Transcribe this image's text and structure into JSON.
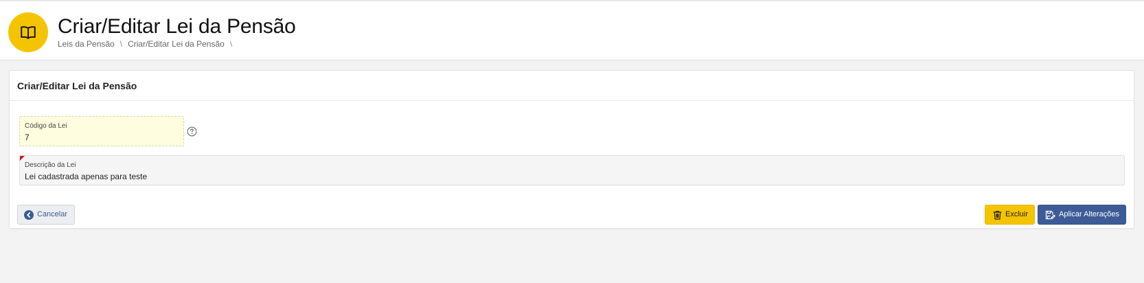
{
  "header": {
    "icon": "book-open-icon",
    "title": "Criar/Editar Lei da Pensão",
    "breadcrumb": [
      {
        "label": "Leis da Pensão"
      },
      {
        "label": "Criar/Editar Lei da Pensão"
      }
    ],
    "breadcrumb_separator": "\\"
  },
  "card": {
    "title": "Criar/Editar Lei da Pensão",
    "fields": {
      "codigo": {
        "label": "Código da Lei",
        "value": "7",
        "help_icon": "question-circle-icon"
      },
      "descricao": {
        "label": "Descrição da Lei",
        "value": "Lei cadastrada apenas para teste",
        "required": true
      }
    },
    "actions": {
      "cancel_label": "Cancelar",
      "cancel_icon": "chevron-left-circle-icon",
      "delete_label": "Excluir",
      "delete_icon": "trash-icon",
      "apply_label": "Aplicar Alterações",
      "apply_icon": "save-edit-icon"
    }
  },
  "colors": {
    "accent_yellow": "#f5c400",
    "primary_blue": "#3d5c97",
    "highlight_field": "#fffde0",
    "required_red": "#d81b1b"
  }
}
